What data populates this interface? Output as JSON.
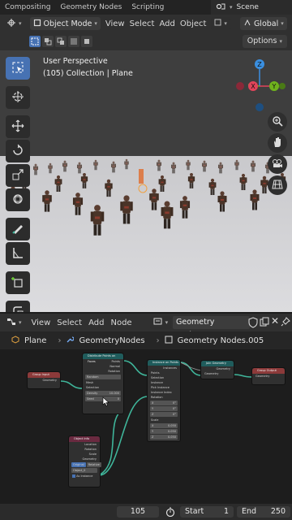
{
  "workspace_tabs": [
    "Compositing",
    "Geometry Nodes",
    "Scripting"
  ],
  "scene": {
    "label": "Scene"
  },
  "viewport_header": {
    "mode": "Object Mode",
    "menus": [
      "View",
      "Select",
      "Add",
      "Object"
    ],
    "orientation": "Global",
    "options_label": "Options"
  },
  "viewport": {
    "perspective": "User Perspective",
    "collection_info": "(105) Collection | Plane",
    "gizmo_axes": {
      "z": "Z",
      "y": "Y",
      "x": "X"
    },
    "tools": [
      "select-box",
      "cursor",
      "move",
      "rotate",
      "scale",
      "transform",
      "annotate",
      "measure",
      "add-cube",
      "extrude"
    ]
  },
  "node_editor_header": {
    "menus": [
      "View",
      "Select",
      "Add",
      "Node"
    ],
    "node_group": "Geometry Nodes.005"
  },
  "breadcrumb": {
    "object": "Plane",
    "modifier": "GeometryNodes",
    "node_group": "Geometry Nodes.005"
  },
  "nodes": {
    "group_input": {
      "title": "Group Input",
      "socket": "Geometry"
    },
    "distribute": {
      "title": "Distribute Points on Faces",
      "outputs": [
        "Points",
        "Normal",
        "Rotation"
      ],
      "mode": "Random",
      "inputs": [
        "Mesh",
        "Selection"
      ],
      "density_label": "Density",
      "density_value": "10.000",
      "seed_label": "Seed",
      "seed_value": "0"
    },
    "instance": {
      "title": "Instance on Points",
      "outputs": [
        "Instances"
      ],
      "inputs": [
        "Points",
        "Selection",
        "Instance",
        "Pick Instance",
        "Instance Index",
        "Rotation"
      ],
      "rot_x": "0°",
      "rot_y": "0°",
      "rot_z": "0°",
      "scale_label": "Scale",
      "scale_x": "0.050",
      "scale_y": "0.050",
      "scale_z": "0.050",
      "axis_x": "X",
      "axis_y": "Y",
      "axis_z": "Z"
    },
    "join": {
      "title": "Join Geometry",
      "socket": "Geometry"
    },
    "group_output": {
      "title": "Group Output",
      "socket": "Geometry"
    },
    "object_info": {
      "title": "Object Info",
      "outputs": [
        "Location",
        "Rotation",
        "Scale",
        "Geometry"
      ],
      "mode_a": "Original",
      "mode_b": "Relative",
      "object": "Object_0",
      "as_instance": "As Instance"
    }
  },
  "timeline": {
    "current_frame": "105",
    "start_label": "Start",
    "start_value": "1",
    "end_label": "End",
    "end_value": "250"
  },
  "colors": {
    "accent": "#4772b3",
    "node_link": "#3fb59a",
    "input_header": "#8c3a3a",
    "geometry_header": "#1f5c5c",
    "object_info_header": "#6a2a40",
    "axis_x": "#e0445a",
    "axis_y": "#6fb31d",
    "axis_z": "#3a8fe0"
  }
}
